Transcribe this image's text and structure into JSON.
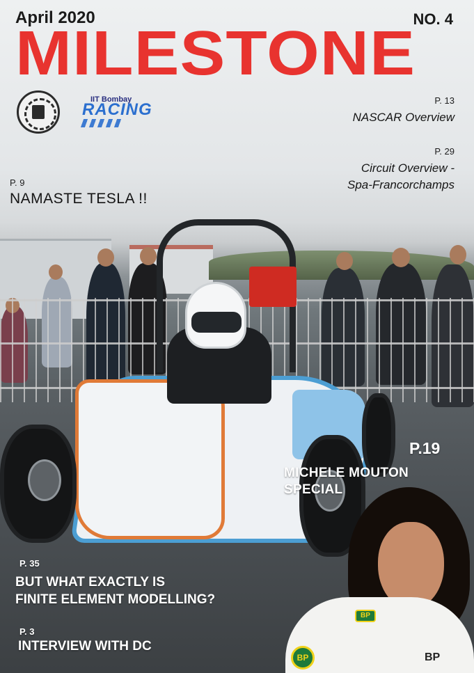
{
  "cover": {
    "date": "April 2020",
    "issue": "NO. 4",
    "title": "MILESTONE",
    "brand_color": "#e8332f"
  },
  "logos": {
    "institute_emblem": "iit-bombay-emblem",
    "team_top": "IIT Bombay",
    "team_name": "RACING"
  },
  "stories": {
    "nascar": {
      "page": "P. 13",
      "headline": "NASCAR Overview"
    },
    "circuit": {
      "page": "P. 29",
      "headline_line1": "Circuit Overview -",
      "headline_line2": "Spa-Francorchamps"
    },
    "tesla": {
      "page": "P. 9",
      "headline": "NAMASTE TESLA !!"
    },
    "mouton": {
      "page": "P.19",
      "headline_line1": "MICHELE MOUTON",
      "headline_line2": "SPECIAL"
    },
    "fem": {
      "page": "P. 35",
      "headline_line1": "BUT WHAT EXACTLY IS",
      "headline_line2": "FINITE ELEMENT MODELLING?"
    },
    "interview": {
      "page": "P. 3",
      "headline": "INTERVIEW WITH DC"
    }
  },
  "photo": {
    "badge_small": "BP",
    "badge_large": "BP",
    "suit_text": "BP"
  }
}
